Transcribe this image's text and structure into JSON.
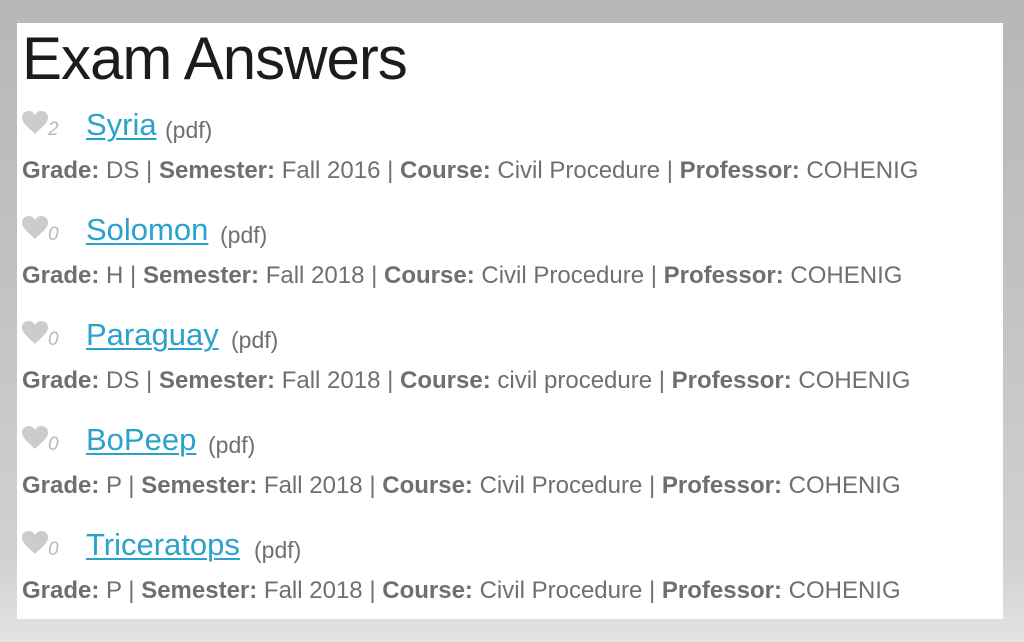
{
  "page": {
    "title": "Exam Answers"
  },
  "labels": {
    "grade": "Grade:",
    "semester": "Semester:",
    "course": "Course:",
    "professor": "Professor:",
    "separator": "|"
  },
  "colors": {
    "link": "#2aa2cc",
    "heart": "#cccccc",
    "meta_text": "#6f6f6f",
    "title_text": "#1c1c1c"
  },
  "exams": [
    {
      "name": "Syria",
      "file_type": "(pdf)",
      "likes": "2",
      "grade": "DS",
      "semester": "Fall 2016",
      "course": "Civil Procedure",
      "professor": "COHENIG"
    },
    {
      "name": "Solomon",
      "file_type": "(pdf)",
      "likes": "0",
      "grade": "H",
      "semester": "Fall 2018",
      "course": "Civil Procedure",
      "professor": "COHENIG"
    },
    {
      "name": "Paraguay",
      "file_type": "(pdf)",
      "likes": "0",
      "grade": "DS",
      "semester": "Fall 2018",
      "course": "civil procedure",
      "professor": "COHENIG"
    },
    {
      "name": "BoPeep",
      "file_type": "(pdf)",
      "likes": "0",
      "grade": "P",
      "semester": "Fall 2018",
      "course": "Civil Procedure",
      "professor": "COHENIG"
    },
    {
      "name": "Triceratops",
      "file_type": "(pdf)",
      "likes": "0",
      "grade": "P",
      "semester": "Fall 2018",
      "course": "Civil Procedure",
      "professor": "COHENIG"
    }
  ]
}
